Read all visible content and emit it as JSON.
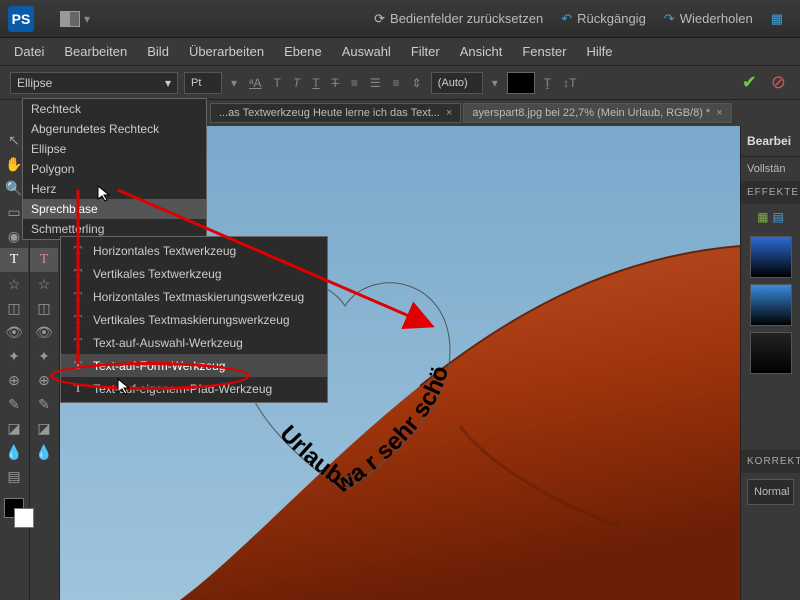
{
  "app_icon_text": "PS",
  "titlebar": {
    "reset_panels": "Bedienfelder zurücksetzen",
    "undo": "Rückgängig",
    "redo": "Wiederholen"
  },
  "menubar": [
    "Datei",
    "Bearbeiten",
    "Bild",
    "Überarbeiten",
    "Ebene",
    "Auswahl",
    "Filter",
    "Ansicht",
    "Fenster",
    "Hilfe"
  ],
  "shape_selected": "Ellipse",
  "font_size_unit": "Pt",
  "auto_label": "(Auto)",
  "shape_options": [
    "Rechteck",
    "Abgerundetes Rechteck",
    "Ellipse",
    "Polygon",
    "Herz",
    "Sprechblase",
    "Schmetterling"
  ],
  "shape_highlight_index": 5,
  "tabs": [
    {
      "label": "...as Textwerkzeug Heute lerne ich das Text..."
    },
    {
      "label": "ayerspart8.jpg bei 22,7% (Mein Urlaub, RGB/8) *"
    }
  ],
  "text_tools": [
    "Horizontales Textwerkzeug",
    "Vertikales Textwerkzeug",
    "Horizontales Textmaskierungswerkzeug",
    "Vertikales Textmaskierungswerkzeug",
    "Text-auf-Auswahl-Werkzeug",
    "Text-auf-Form-Werkzeug",
    "Text-auf-eigenem-Pfad-Werkzeug"
  ],
  "text_tool_selected_index": 5,
  "rightpanel": {
    "title": "Bearbei",
    "mode": "Vollstän",
    "effects": "EFFEKTE",
    "corrections": "KORREKT",
    "blend": "Normal"
  },
  "path_text": {
    "c1": "Urlaub",
    "c2": "wa",
    "c3": "r",
    "c4": " sehr",
    "c5": "schö"
  },
  "thumb_colors": [
    "#2c6bd4",
    "#3a8be0",
    "#222222"
  ]
}
